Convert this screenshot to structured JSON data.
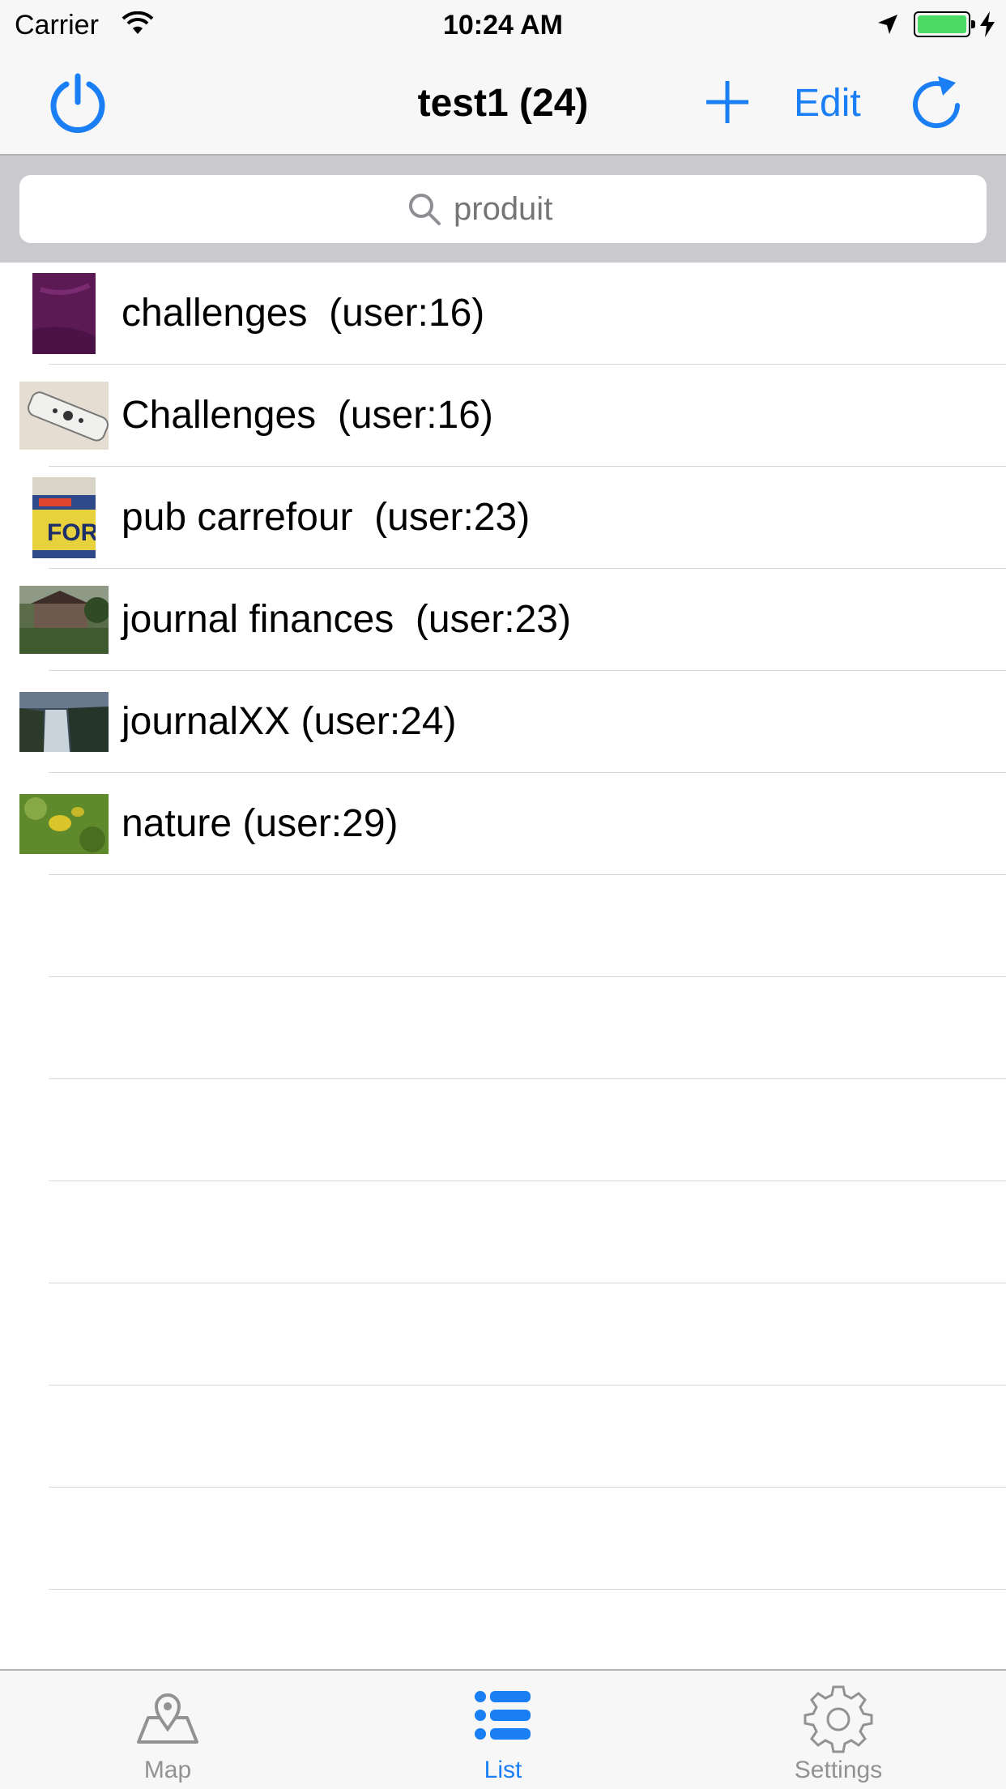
{
  "status_bar": {
    "carrier": "Carrier",
    "time": "10:24 AM"
  },
  "nav": {
    "title": "test1 (24)",
    "edit_label": "Edit",
    "accent_color": "#1a7ef5"
  },
  "search": {
    "placeholder": "produit"
  },
  "list": {
    "items": [
      {
        "label": "challenges  (user:16)",
        "thumb": "purple-fabric-photo"
      },
      {
        "label": "Challenges  (user:16)",
        "thumb": "remote-control-photo"
      },
      {
        "label": "pub carrefour  (user:23)",
        "thumb": "carrefour-flyer-photo"
      },
      {
        "label": "journal finances  (user:23)",
        "thumb": "house-garden-photo"
      },
      {
        "label": "journalXX (user:24)",
        "thumb": "waterfall-photo"
      },
      {
        "label": "nature (user:29)",
        "thumb": "lemon-tree-photo"
      }
    ]
  },
  "tab_bar": {
    "tabs": [
      {
        "label": "Map",
        "icon": "map-pin-icon"
      },
      {
        "label": "List",
        "icon": "list-icon",
        "active": true
      },
      {
        "label": "Settings",
        "icon": "gear-icon"
      }
    ]
  }
}
